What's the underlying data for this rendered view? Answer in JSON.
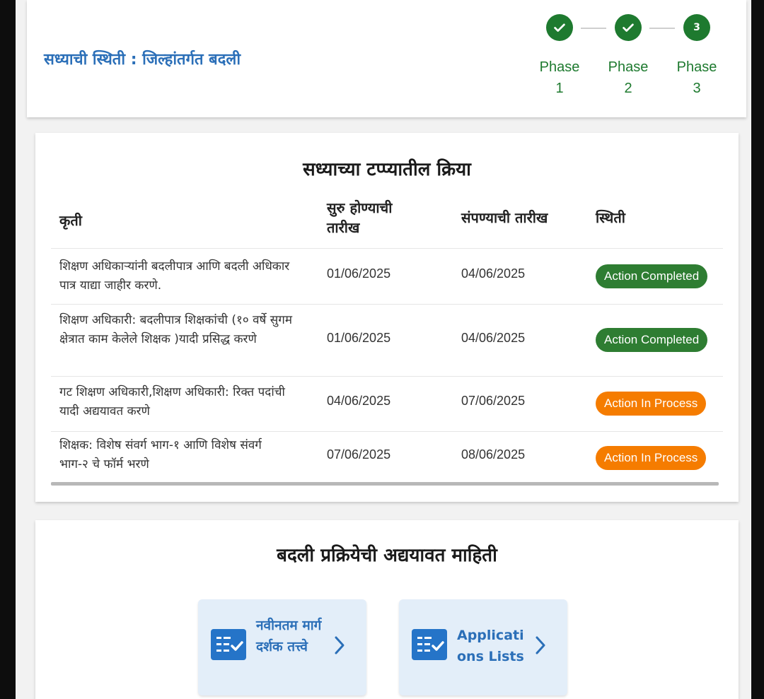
{
  "status": {
    "label": "सध्याची स्थिती : जिल्हांतर्गत बदली",
    "phases": [
      {
        "name": "Phase",
        "number": "1",
        "state": "done"
      },
      {
        "name": "Phase",
        "number": "2",
        "state": "done"
      },
      {
        "name": "Phase",
        "number": "3",
        "state": "current",
        "circle_text": "3"
      }
    ],
    "accent_color": "#1e7a2f"
  },
  "actions": {
    "title": "सध्याच्या टप्प्यातील क्रिया",
    "headers": {
      "task": "कृती",
      "start": "सुरु होण्याची तारीख",
      "end": "संपण्याची तारीख",
      "status": "स्थिती"
    },
    "rows": [
      {
        "task": "शिक्षण अधिकाऱ्यांनी बदलीपात्र आणि बदली अधिकार पात्र याद्या जाहीर करणे.",
        "start": "01/06/2025",
        "end": "04/06/2025",
        "status": "Action Completed",
        "status_color": "#2e7d32"
      },
      {
        "task": "शिक्षण अधिकारी: बदलीपात्र शिक्षकांची (१० वर्षे सुगम क्षेत्रात काम केलेले शिक्षक )यादी प्रसिद्ध करणे",
        "start": "01/06/2025",
        "end": "04/06/2025",
        "status": "Action Completed",
        "status_color": "#2e7d32"
      },
      {
        "task": "गट शिक्षण अधिकारी,शिक्षण अधिकारी: रिक्त पदांची यादी अद्ययावत करणे",
        "start": "04/06/2025",
        "end": "07/06/2025",
        "status": "Action In Process",
        "status_color": "#f57c00"
      },
      {
        "task": "शिक्षक: विशेष संवर्ग भाग-१ आणि विशेष संवर्ग भाग-२ चे फॉर्म भरणे",
        "start": "07/06/2025",
        "end": "08/06/2025",
        "status": "Action In Process",
        "status_color": "#f57c00"
      }
    ]
  },
  "info": {
    "title": "बदली प्रक्रियेची अद्ययावत माहिती",
    "links": [
      {
        "label": "नवीनतम मार्गदर्शक तत्त्वे",
        "icon": "checklist-icon"
      },
      {
        "label": "Applications Lists",
        "icon": "checklist-icon"
      }
    ]
  }
}
